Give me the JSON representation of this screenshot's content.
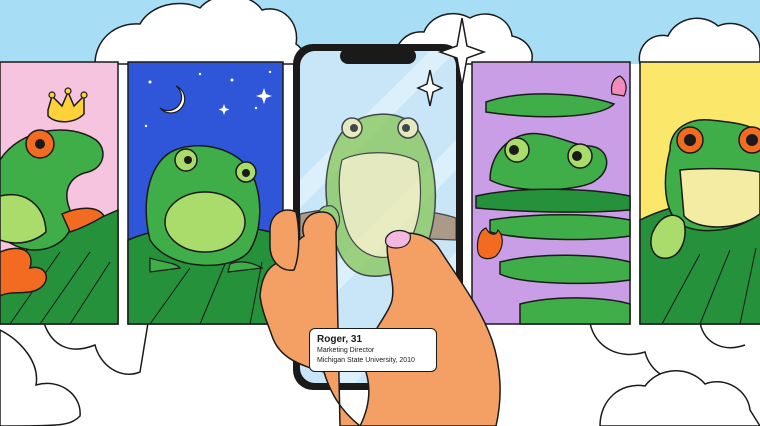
{
  "illustration": {
    "colors": {
      "sky": "#a8def5",
      "cloud": "#ffffff",
      "outline": "#1a1a1a",
      "frog_green": "#3fae49",
      "frog_light": "#a9dc6a",
      "frog_belly": "#f4eca3",
      "leaf_dark": "#25913b",
      "card_pink": "#f6c4de",
      "card_night": "#2f56d9",
      "card_purple": "#d8a7ea",
      "card_yellow": "#fbe86b",
      "water": "#c99ee6",
      "orange": "#f36b21",
      "crown": "#ffd23a",
      "skin": "#f4a064",
      "nail": "#f2b8df",
      "phone_screen": "#c8e6f7"
    },
    "profile": {
      "name": "Roger, 31",
      "title": "Marketing Director",
      "education": "Michigan State University, 2010"
    }
  }
}
